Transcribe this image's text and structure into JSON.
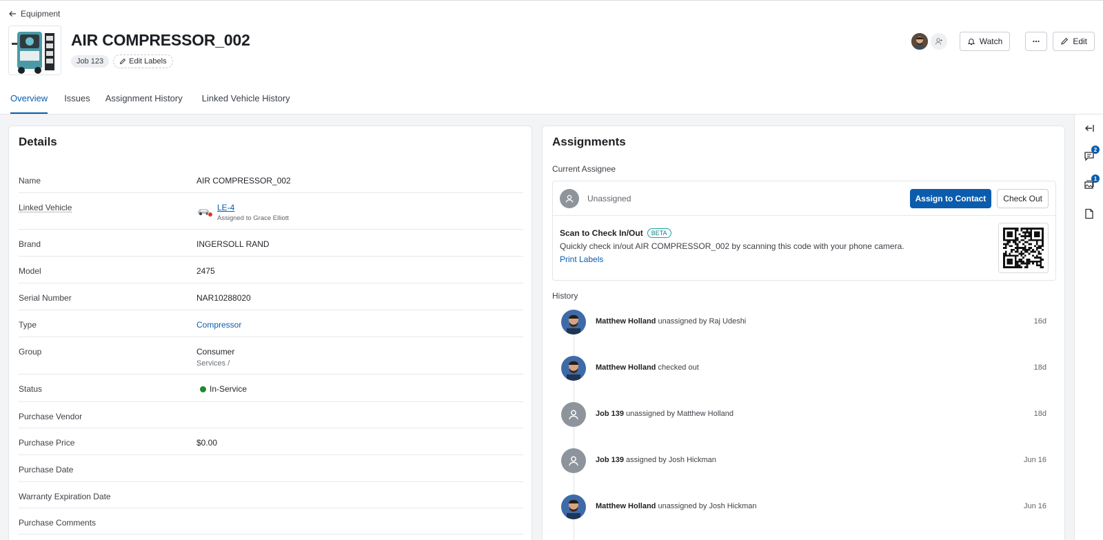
{
  "header": {
    "back_label": "Equipment",
    "title": "AIR COMPRESSOR_002",
    "job_chip": "Job 123",
    "edit_labels": "Edit Labels",
    "watch_label": "Watch",
    "edit_label": "Edit"
  },
  "tabs": [
    {
      "label": "Overview",
      "active": true
    },
    {
      "label": "Issues",
      "active": false
    },
    {
      "label": "Assignment History",
      "active": false
    },
    {
      "label": "Linked Vehicle History",
      "active": false
    }
  ],
  "details": {
    "title": "Details",
    "rows": {
      "name": {
        "label": "Name",
        "value": "AIR COMPRESSOR_002"
      },
      "linked_vehicle": {
        "label": "Linked Vehicle",
        "value": "LE-4",
        "sub": "Assigned to Grace Elliott"
      },
      "brand": {
        "label": "Brand",
        "value": "INGERSOLL RAND"
      },
      "model": {
        "label": "Model",
        "value": "2475"
      },
      "serial": {
        "label": "Serial Number",
        "value": "NAR10288020"
      },
      "type": {
        "label": "Type",
        "value": "Compressor"
      },
      "group": {
        "label": "Group",
        "value": "Consumer",
        "sub": "Services /"
      },
      "status": {
        "label": "Status",
        "value": "In-Service",
        "color": "#1c8a2f"
      },
      "purchase_vendor": {
        "label": "Purchase Vendor",
        "value": ""
      },
      "purchase_price": {
        "label": "Purchase Price",
        "value": "$0.00"
      },
      "purchase_date": {
        "label": "Purchase Date",
        "value": ""
      },
      "warranty": {
        "label": "Warranty Expiration Date",
        "value": ""
      },
      "purchase_comments": {
        "label": "Purchase Comments",
        "value": ""
      }
    }
  },
  "assignments": {
    "title": "Assignments",
    "current_assignee_heading": "Current Assignee",
    "assignee": "Unassigned",
    "assign_button": "Assign to Contact",
    "checkout_button": "Check Out",
    "scan_title": "Scan to Check In/Out",
    "beta": "BETA",
    "scan_desc": "Quickly check in/out  AIR COMPRESSOR_002  by scanning this code with your phone camera.",
    "print_labels": "Print Labels",
    "history_heading": "History",
    "history": [
      {
        "actor": "Matthew Holland",
        "action": "unassigned by Raj Udeshi",
        "time": "16d",
        "avatar": "photo"
      },
      {
        "actor": "Matthew Holland",
        "action": "checked out",
        "time": "18d",
        "avatar": "photo"
      },
      {
        "actor": "Job 139",
        "action": "unassigned by Matthew Holland",
        "time": "18d",
        "avatar": "placeholder"
      },
      {
        "actor": "Job 139",
        "action": "assigned by Josh Hickman",
        "time": "Jun 16",
        "avatar": "placeholder"
      },
      {
        "actor": "Matthew Holland",
        "action": "unassigned by Josh Hickman",
        "time": "Jun 16",
        "avatar": "photo"
      }
    ]
  },
  "rail": {
    "comments_count": "2",
    "photos_count": "1"
  },
  "colors": {
    "accent": "#0b5cad",
    "status_green": "#1c8a2f",
    "beta_teal": "#17a39b"
  }
}
